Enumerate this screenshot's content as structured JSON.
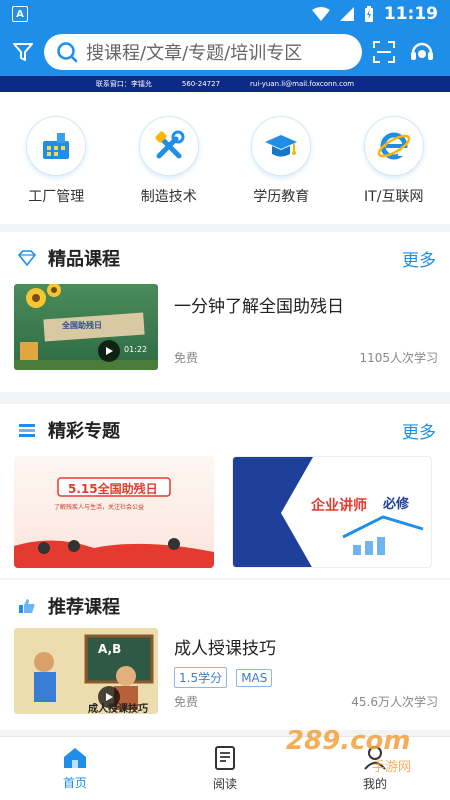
{
  "status_bar": {
    "app_badge": "A",
    "time": "11:19"
  },
  "search": {
    "placeholder": "搜课程/文章/专题/培训专区"
  },
  "contact_strip": {
    "contact": "联系窗口：李镭允",
    "phone": "560-24727",
    "email": "rui-yuan.li@mail.foxconn.com"
  },
  "categories": [
    {
      "label": "工厂管理",
      "icon": "factory-icon"
    },
    {
      "label": "制造技术",
      "icon": "tools-icon"
    },
    {
      "label": "学历教育",
      "icon": "graduation-cap-icon"
    },
    {
      "label": "IT/互联网",
      "icon": "ie-browser-icon"
    }
  ],
  "featured": {
    "title": "精品课程",
    "more": "更多",
    "course": {
      "title": "一分钟了解全国助残日",
      "price": "免费",
      "learners": "1105人次学习",
      "thumb_banner": "全国助残日",
      "duration": "01:22"
    }
  },
  "topics": {
    "title": "精彩专题",
    "more": "更多",
    "cards": [
      {
        "banner": "5.15全国助残日",
        "caption": "了解残疾人与生活，关注社会公益"
      },
      {
        "banner": "企业讲师",
        "banner2": "必修"
      }
    ]
  },
  "recommended": {
    "title": "推荐课程",
    "course": {
      "title": "成人授课技巧",
      "tags": [
        "1.5学分",
        "MAS"
      ],
      "price": "免费",
      "learners": "45.6万人次学习",
      "thumb_caption": "成人授课技巧",
      "thumb_board": "A,B"
    }
  },
  "tabbar": [
    {
      "label": "首页",
      "icon": "home-icon",
      "active": true
    },
    {
      "label": "阅读",
      "icon": "book-icon",
      "active": false
    },
    {
      "label": "我的",
      "icon": "profile-icon",
      "active": false
    }
  ],
  "watermark": {
    "logo": "289.com",
    "sub": "手游网"
  },
  "colors": {
    "primary": "#1e8ee8",
    "strip": "#0d2a86",
    "background": "#f2f3f5"
  }
}
